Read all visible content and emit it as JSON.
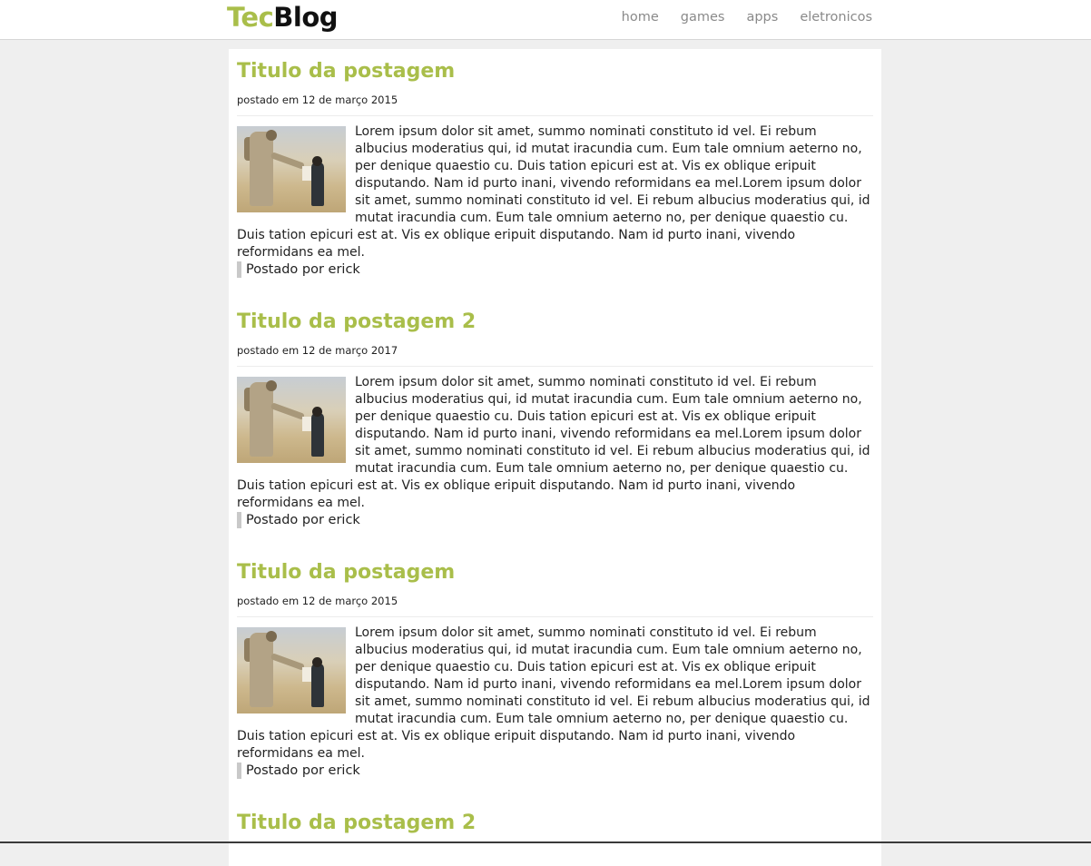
{
  "header": {
    "logo_part1": "Tec",
    "logo_part2": "Blog",
    "nav": [
      "home",
      "games",
      "apps",
      "eletronicos"
    ]
  },
  "posts": [
    {
      "title": "Titulo da postagem",
      "date": "postado em 12 de março 2015",
      "image_icon": "soldier-child-photo",
      "body": "Lorem ipsum dolor sit amet, summo nominati constituto id vel. Ei rebum albucius moderatius qui, id mutat iracundia cum. Eum tale omnium aeterno no, per denique quaestio cu. Duis tation epicuri est at. Vis ex oblique eripuit disputando. Nam id purto inani, vivendo reformidans ea mel.Lorem ipsum dolor sit amet, summo nominati constituto id vel. Ei rebum albucius moderatius qui, id mutat iracundia cum. Eum tale omnium aeterno no, per denique quaestio cu. Duis tation epicuri est at. Vis ex oblique eripuit disputando. Nam id purto inani, vivendo reformidans ea mel.",
      "author": "Postado por erick"
    },
    {
      "title": "Titulo da postagem 2",
      "date": "postado em 12 de março 2017",
      "image_icon": "soldier-child-photo",
      "body": "Lorem ipsum dolor sit amet, summo nominati constituto id vel. Ei rebum albucius moderatius qui, id mutat iracundia cum. Eum tale omnium aeterno no, per denique quaestio cu. Duis tation epicuri est at. Vis ex oblique eripuit disputando. Nam id purto inani, vivendo reformidans ea mel.Lorem ipsum dolor sit amet, summo nominati constituto id vel. Ei rebum albucius moderatius qui, id mutat iracundia cum. Eum tale omnium aeterno no, per denique quaestio cu. Duis tation epicuri est at. Vis ex oblique eripuit disputando. Nam id purto inani, vivendo reformidans ea mel.",
      "author": "Postado por erick"
    },
    {
      "title": "Titulo da postagem",
      "date": "postado em 12 de março 2015",
      "image_icon": "soldier-child-photo",
      "body": "Lorem ipsum dolor sit amet, summo nominati constituto id vel. Ei rebum albucius moderatius qui, id mutat iracundia cum. Eum tale omnium aeterno no, per denique quaestio cu. Duis tation epicuri est at. Vis ex oblique eripuit disputando. Nam id purto inani, vivendo reformidans ea mel.Lorem ipsum dolor sit amet, summo nominati constituto id vel. Ei rebum albucius moderatius qui, id mutat iracundia cum. Eum tale omnium aeterno no, per denique quaestio cu. Duis tation epicuri est at. Vis ex oblique eripuit disputando. Nam id purto inani, vivendo reformidans ea mel.",
      "author": "Postado por erick"
    },
    {
      "title": "Titulo da postagem 2"
    }
  ],
  "colors": {
    "accent": "#a9be4a",
    "background": "#efefef",
    "nav_text": "#8a8a8a"
  }
}
